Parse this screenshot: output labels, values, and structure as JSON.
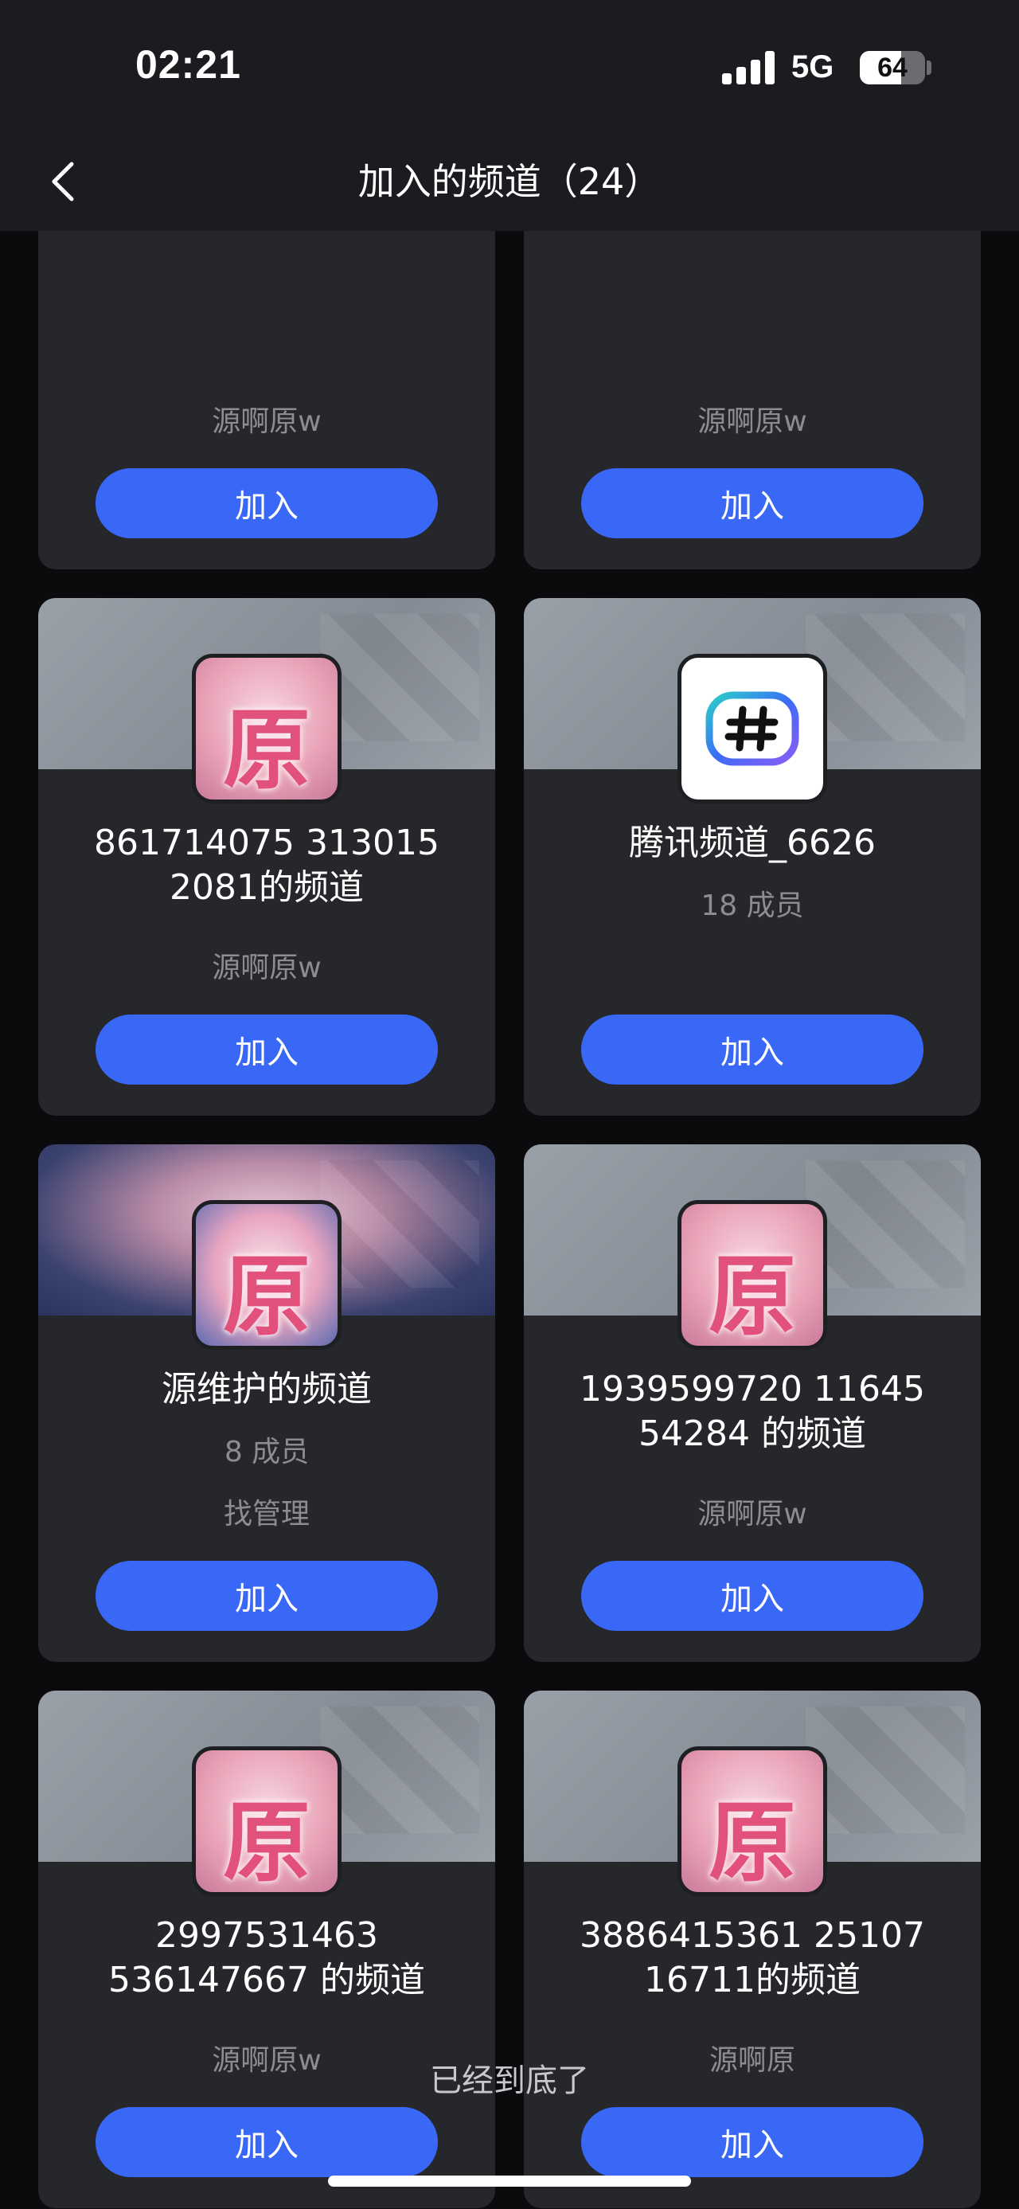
{
  "status_bar": {
    "time": "02:21",
    "network": "5G",
    "battery_level": "64",
    "battery_fraction": 0.64
  },
  "nav": {
    "title": "加入的频道（24）",
    "back_icon": "chevron-left-icon"
  },
  "colors": {
    "accent": "#3a68f6",
    "card_bg": "#26272b",
    "bar_bg": "#1b1c20",
    "page_bg": "#0b0b0e"
  },
  "channels": [
    {
      "name": "",
      "members": "",
      "owner": "源啊原w",
      "button": "加入",
      "avatar": "pink-yuan-avatar"
    },
    {
      "name": "",
      "members": "",
      "owner": "源啊原w",
      "button": "加入",
      "avatar": "pink-yuan-avatar"
    },
    {
      "name": "861714075 313015 2081的频道",
      "members": "",
      "owner": "源啊原w",
      "button": "加入",
      "avatar": "pink-yuan-avatar"
    },
    {
      "name": "腾讯频道_6626",
      "members": "18 成员",
      "owner": "",
      "button": "加入",
      "avatar": "hashtag-avatar"
    },
    {
      "name": "源维护的频道",
      "members": "8 成员",
      "owner": "找管理",
      "button": "加入",
      "avatar": "cloud-yuan-avatar"
    },
    {
      "name": "1939599720 11645 54284 的频道",
      "members": "",
      "owner": "源啊原w",
      "button": "加入",
      "avatar": "pink-yuan-avatar"
    },
    {
      "name": "2997531463 536147667 的频道",
      "members": "",
      "owner": "源啊原w",
      "button": "加入",
      "avatar": "pink-yuan-avatar"
    },
    {
      "name": "3886415361 25107 16711的频道",
      "members": "",
      "owner": "源啊原",
      "button": "加入",
      "avatar": "pink-yuan-avatar"
    }
  ],
  "avatar_glyph": "原",
  "hashtag_glyph": "#",
  "footer": {
    "end_text": "已经到底了"
  }
}
